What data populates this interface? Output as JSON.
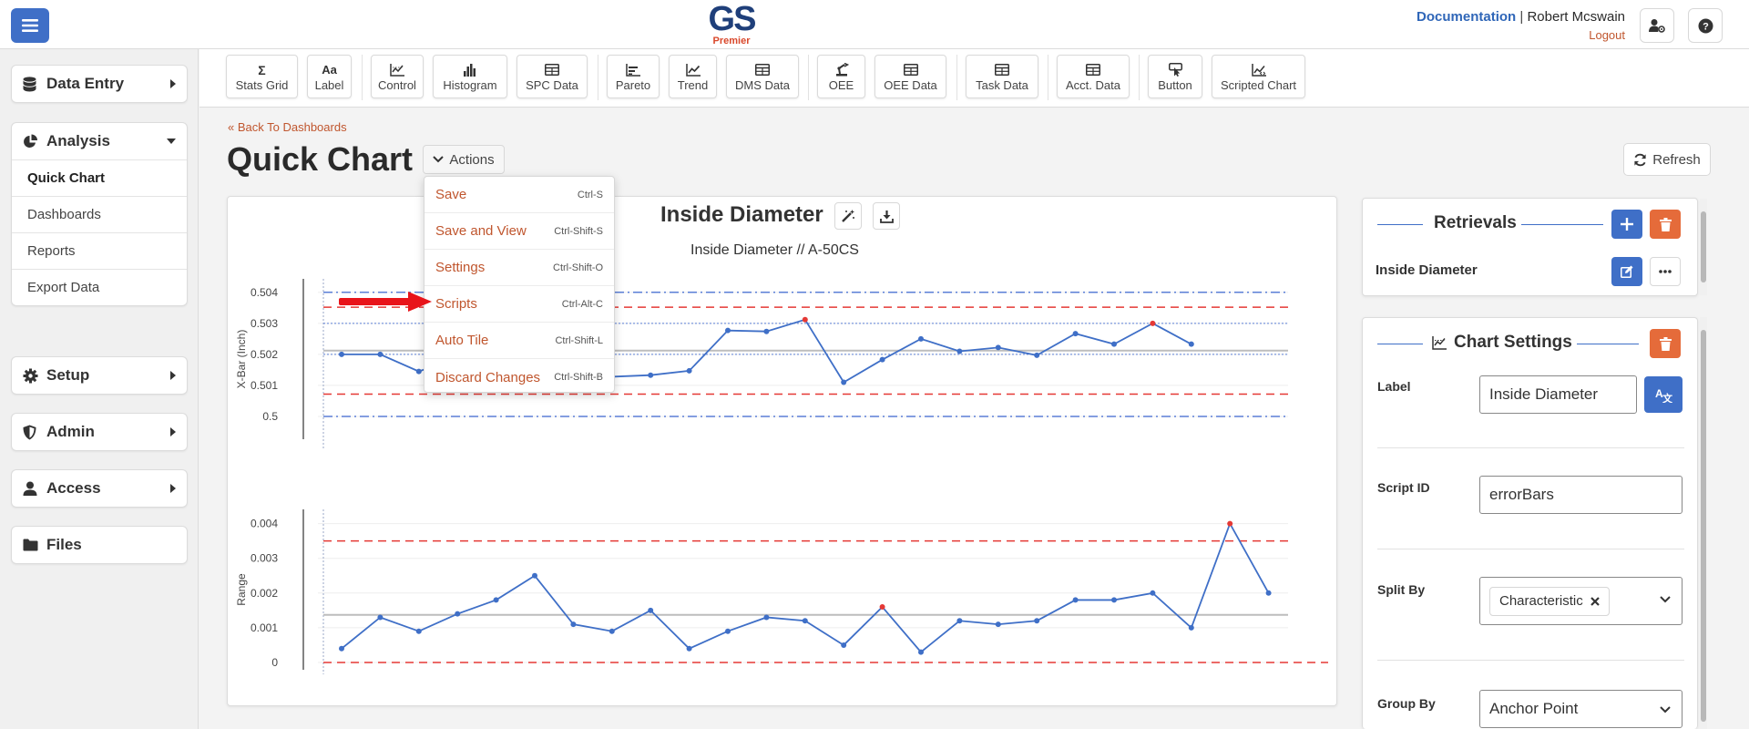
{
  "app": {
    "logo_main": "GS",
    "logo_sub": "Premier",
    "documentation_link": "Documentation",
    "user_name": "Robert Mcswain",
    "logout_link": "Logout"
  },
  "sidebar": {
    "data_entry": "Data Entry",
    "analysis": "Analysis",
    "analysis_items": [
      "Quick Chart",
      "Dashboards",
      "Reports",
      "Export Data"
    ],
    "setup": "Setup",
    "admin": "Admin",
    "access": "Access",
    "files": "Files"
  },
  "toolbar": {
    "buttons": [
      {
        "label": "Stats Grid",
        "icon": "sigma-icon"
      },
      {
        "label": "Label",
        "icon": "text-aa-icon"
      },
      {
        "label": "Control",
        "icon": "control-chart-icon"
      },
      {
        "label": "Histogram",
        "icon": "histogram-icon"
      },
      {
        "label": "SPC Data",
        "icon": "table-icon"
      },
      {
        "label": "Pareto",
        "icon": "pareto-icon"
      },
      {
        "label": "Trend",
        "icon": "trend-icon"
      },
      {
        "label": "DMS Data",
        "icon": "table-icon"
      },
      {
        "label": "OEE",
        "icon": "robot-arm-icon"
      },
      {
        "label": "OEE Data",
        "icon": "table-icon"
      },
      {
        "label": "Task Data",
        "icon": "table-icon"
      },
      {
        "label": "Acct. Data",
        "icon": "table-icon"
      },
      {
        "label": "Button",
        "icon": "pointer-button-icon"
      },
      {
        "label": "Scripted Chart",
        "icon": "scripted-chart-icon"
      }
    ],
    "stats_grid_glyph": "Σ",
    "label_glyph": "Aa"
  },
  "page": {
    "back_link": "Back To Dashboards",
    "title": "Quick Chart",
    "actions_label": "Actions",
    "refresh_label": "Refresh"
  },
  "actions_menu": {
    "items": [
      {
        "label": "Save",
        "shortcut": "Ctrl-S"
      },
      {
        "label": "Save and View",
        "shortcut": "Ctrl-Shift-S"
      },
      {
        "label": "Settings",
        "shortcut": "Ctrl-Shift-O"
      },
      {
        "label": "Scripts",
        "shortcut": "Ctrl-Alt-C"
      },
      {
        "label": "Auto Tile",
        "shortcut": "Ctrl-Shift-L"
      },
      {
        "label": "Discard Changes",
        "shortcut": "Ctrl-Shift-B"
      }
    ],
    "highlighted_item": "Scripts"
  },
  "chart_header": {
    "title": "Inside Diameter",
    "subtitle": "Inside Diameter  //  A-50CS"
  },
  "chart_data": [
    {
      "type": "line",
      "ylabel": "X-Bar (Inch)",
      "ylim": [
        0.4995,
        0.5042
      ],
      "yticks": [
        "0.504",
        "0.503",
        "0.502",
        "0.501",
        "0.5"
      ],
      "ytick_values": [
        0.504,
        0.503,
        0.502,
        0.501,
        0.5
      ],
      "x": [
        1,
        2,
        3,
        4,
        5,
        6,
        7,
        8,
        9,
        10,
        11,
        12,
        13,
        14,
        15,
        16,
        17,
        18,
        19,
        20,
        21,
        22,
        23,
        24,
        25,
        26
      ],
      "values": [
        0.502,
        0.502,
        0.50145,
        0.5019,
        0.50215,
        0.5017,
        0.50255,
        0.50128,
        0.50133,
        0.50147,
        0.50277,
        0.50274,
        0.50312,
        0.5011,
        0.50183,
        0.5025,
        0.5021,
        0.50222,
        0.50197,
        0.50267,
        0.50233,
        0.503,
        0.50233
      ],
      "out_of_control_points": [
        13,
        22
      ],
      "center_line": 0.50212,
      "ucl": 0.50352,
      "lcl": 0.50072,
      "spec_upper": 0.504,
      "spec_lower": 0.5,
      "sigma_lines": [
        0.503,
        0.502
      ],
      "colors": {
        "series": "#3f6fc7",
        "out_of_control": "#e53935",
        "limits": "#e53935",
        "spec": "#5b7fd6",
        "center": "#bdbdbd"
      }
    },
    {
      "type": "line",
      "ylabel": "Range",
      "ylim": [
        0,
        0.0042
      ],
      "yticks": [
        "0.004",
        "0.003",
        "0.002",
        "0.001",
        "0"
      ],
      "ytick_values": [
        0.004,
        0.003,
        0.002,
        0.001,
        0
      ],
      "x": [
        1,
        2,
        3,
        4,
        5,
        6,
        7,
        8,
        9,
        10,
        11,
        12,
        13,
        14,
        15,
        16,
        17,
        18,
        19,
        20,
        21,
        22,
        23,
        24,
        25,
        26
      ],
      "values": [
        0.0004,
        0.0013,
        0.0009,
        0.0014,
        0.0018,
        0.0025,
        0.0011,
        0.0009,
        0.0015,
        0.0004,
        0.0009,
        0.0013,
        0.0012,
        0.0005,
        0.0016,
        0.0003,
        0.0012,
        0.0011,
        0.0012,
        0.0018,
        0.0018,
        0.002,
        0.001,
        0.004,
        0.002
      ],
      "out_of_control_points": [
        15,
        24
      ],
      "center_line": 0.00137,
      "ucl": 0.0035,
      "lcl": 0,
      "colors": {
        "series": "#3f6fc7",
        "out_of_control": "#e53935",
        "limits": "#e53935",
        "center": "#bdbdbd"
      }
    }
  ],
  "retrievals_panel": {
    "title": "Retrievals",
    "item_label": "Inside Diameter"
  },
  "chart_settings_panel": {
    "title": "Chart Settings",
    "fields": {
      "label": {
        "name": "Label",
        "value": "Inside Diameter"
      },
      "script_id": {
        "name": "Script ID",
        "value": "errorBars"
      },
      "split_by": {
        "name": "Split By",
        "value": "Characteristic"
      },
      "group_by": {
        "name": "Group By",
        "value": "Anchor Point"
      }
    }
  }
}
